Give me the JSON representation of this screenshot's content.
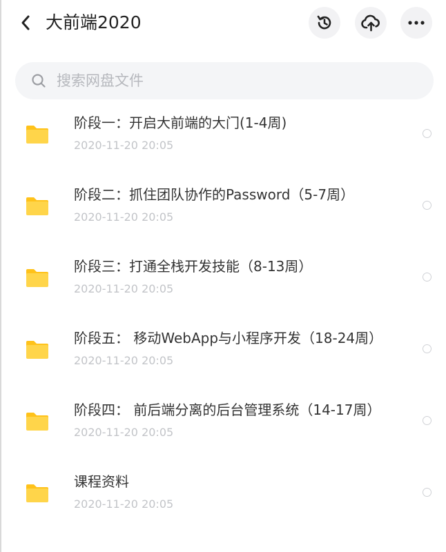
{
  "header": {
    "title": "大前端2020",
    "icons": [
      "back-icon",
      "history-icon",
      "cloud-upload-icon",
      "more-icon"
    ]
  },
  "search": {
    "placeholder": "搜索网盘文件"
  },
  "colors": {
    "folder": "#ffd54a",
    "folder_tab": "#ffc21a",
    "date_text": "#c2c4c8",
    "search_bg": "#f4f5f7"
  },
  "files": [
    {
      "name": "阶段一：开启大前端的大门(1-4周)",
      "date": "2020-11-20 20:05"
    },
    {
      "name": "阶段二：抓住团队协作的Password（5-7周）",
      "date": "2020-11-20 20:05"
    },
    {
      "name": "阶段三：打通全栈开发技能（8-13周）",
      "date": "2020-11-20 20:05"
    },
    {
      "name": "阶段五： 移动WebApp与小程序开发（18-24周）",
      "date": "2020-11-20 20:05"
    },
    {
      "name": "阶段四： 前后端分离的后台管理系统（14-17周）",
      "date": "2020-11-20 20:05"
    },
    {
      "name": "课程资料",
      "date": "2020-11-20 20:05"
    }
  ]
}
